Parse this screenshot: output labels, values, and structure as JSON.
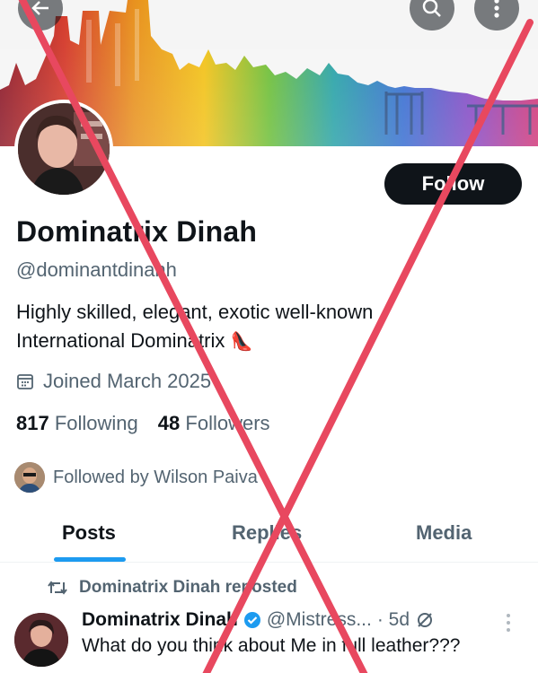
{
  "profile": {
    "display_name": "Dominatrix Dinah",
    "handle": "@dominantdinahh",
    "bio_line1": "Highly skilled, elegant, exotic well-known",
    "bio_line2": "International Dominatrix",
    "bio_emoji": "👠",
    "joined": "Joined March 2025",
    "following_count": "817",
    "following_label": "Following",
    "followers_count": "48",
    "followers_label": "Followers",
    "followed_by": "Followed by Wilson Paiva"
  },
  "actions": {
    "follow_label": "Follow"
  },
  "tabs": [
    {
      "label": "Posts",
      "active": true
    },
    {
      "label": "Replies",
      "active": false
    },
    {
      "label": "Media",
      "active": false
    }
  ],
  "post": {
    "repost_text": "Dominatrix Dinah reposted",
    "author_name": "Dominatrix Dinah",
    "author_handle": "@Mistress...",
    "time": "· 5d",
    "text": "What do you think about Me in full leather???"
  },
  "icons": {
    "back": "back-arrow-icon",
    "search": "search-icon",
    "more": "more-vertical-icon",
    "calendar": "calendar-icon",
    "repost": "repost-icon",
    "verified": "verified-badge-icon",
    "grok": "grok-icon"
  },
  "colors": {
    "accent": "#1d9bf0",
    "text_primary": "#0f1419",
    "text_secondary": "#536471",
    "overlay_cross": "#e8485f"
  }
}
